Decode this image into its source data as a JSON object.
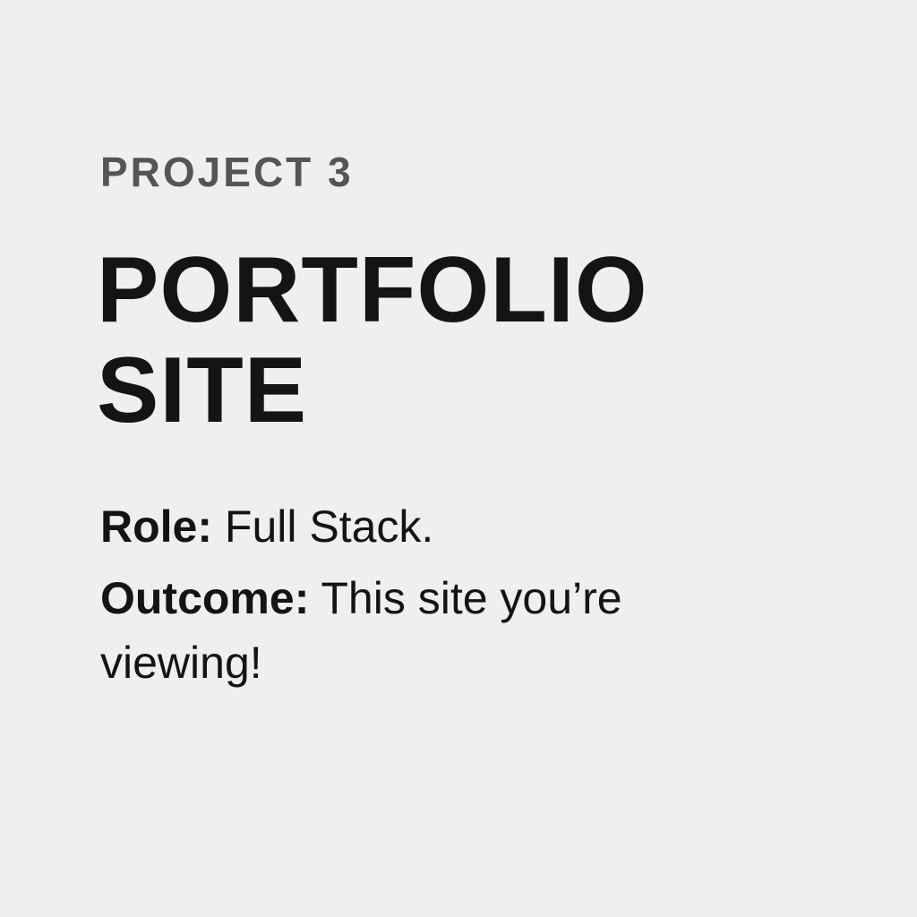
{
  "project": {
    "eyebrow": "PROJECT 3",
    "title_line1": "PORTFOLIO",
    "title_line2": "SITE",
    "role_label": "Role:",
    "role_value": "Full Stack.",
    "outcome_label": "Outcome:",
    "outcome_value": "This site you’re viewing!"
  },
  "colors": {
    "background": "#efefef",
    "eyebrow": "#555555",
    "text": "#141414"
  }
}
